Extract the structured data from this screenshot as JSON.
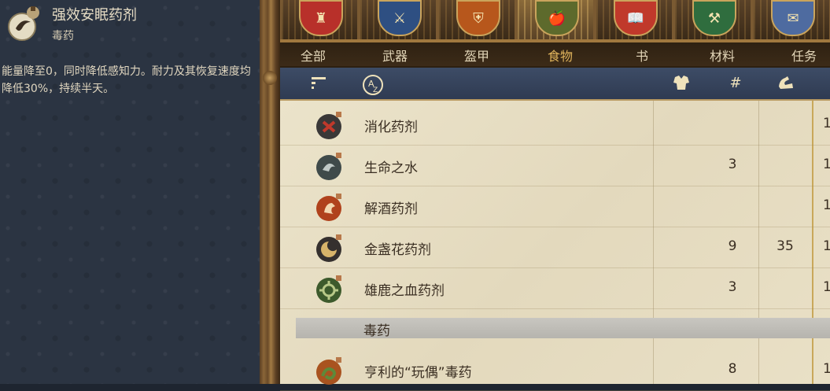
{
  "item_info": {
    "title": "强效安眠药剂",
    "category": "毒药",
    "description": "能量降至0，同时降低感知力。耐力及其恢复速度均降低30%，持续半天。",
    "icon": "sleeping-potion-icon"
  },
  "tabs": [
    {
      "label": "全部",
      "icon": "castle-icon",
      "color": "#b8302a",
      "active": false
    },
    {
      "label": "武器",
      "icon": "sword-icon",
      "color": "#2e4f82",
      "active": false
    },
    {
      "label": "盔甲",
      "icon": "armor-icon",
      "color": "#b7571c",
      "active": false
    },
    {
      "label": "食物",
      "icon": "food-icon",
      "color": "#5d6a2c",
      "active": true
    },
    {
      "label": "书",
      "icon": "book-icon",
      "color": "#c0392b",
      "active": false
    },
    {
      "label": "材料",
      "icon": "materials-icon",
      "color": "#2f6d3e",
      "active": false
    },
    {
      "label": "任务",
      "icon": "quest-icon",
      "color": "#4e6ba0",
      "active": false
    }
  ],
  "sort_icons": [
    "sort-type-icon",
    "sort-alpha-icon",
    "sort-quality-icon",
    "sort-count-icon",
    "sort-weight-icon"
  ],
  "rows": [
    {
      "name": "消化药剂",
      "col1": "",
      "col2": "",
      "col3": "1",
      "icon": "digestive-potion-icon",
      "color": "#3a3838",
      "accent": "#c0392b"
    },
    {
      "name": "生命之水",
      "col1": "3",
      "col2": "",
      "col3": "1",
      "icon": "aqua-vitalis-icon",
      "color": "#3f4a4a",
      "accent": "#bfc8c6"
    },
    {
      "name": "解酒药剂",
      "col1": "",
      "col2": "",
      "col3": "1",
      "icon": "hair-of-the-dog-icon",
      "color": "#b0421c",
      "accent": "#f2d8b0"
    },
    {
      "name": "金盏花药剂",
      "col1": "9",
      "col2": "35",
      "col3": "1",
      "icon": "marigold-potion-icon",
      "color": "#35302e",
      "accent": "#d8b46a"
    },
    {
      "name": "雄鹿之血药剂",
      "col1": "3",
      "col2": "",
      "col3": "1",
      "icon": "bucks-blood-icon",
      "color": "#3d5a2c",
      "accent": "#b8c888"
    }
  ],
  "group_label": "毒药",
  "poison_rows": [
    {
      "name": "亨利的“玩偶”毒药",
      "col1": "8",
      "col2": "",
      "col3": "1",
      "icon": "henrys-poison-icon",
      "color": "#a9531f",
      "accent": "#5d8a3a"
    }
  ]
}
